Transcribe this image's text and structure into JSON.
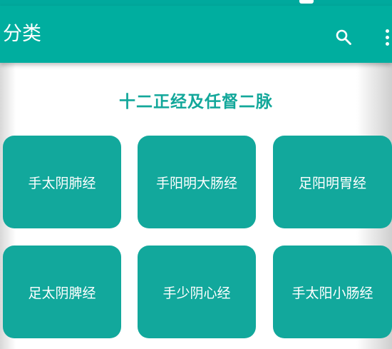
{
  "app_bar": {
    "title": "分类",
    "actions": [
      "search-icon",
      "more-vert-icon"
    ]
  },
  "section": {
    "title": "十二正经及任督二脉"
  },
  "cards": [
    {
      "label": "手太阴肺经"
    },
    {
      "label": "手阳明大肠经"
    },
    {
      "label": "足阳明胃经"
    },
    {
      "label": "足太阴脾经"
    },
    {
      "label": "手少阴心经"
    },
    {
      "label": "手太阳小肠经"
    }
  ],
  "colors": {
    "primary": "#00ae9f",
    "card": "#12a89c",
    "section_title": "#12a79a"
  }
}
